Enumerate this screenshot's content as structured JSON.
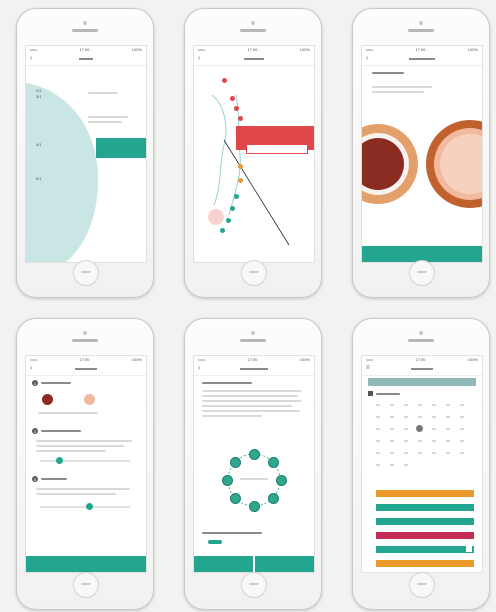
{
  "status_bar": {
    "carrier": "•••••",
    "time": "17:00",
    "battery": "100%"
  },
  "colors": {
    "teal": "#23a590",
    "dark_teal": "#1c7e6c",
    "light_teal": "#c9e5e4",
    "red": "#e0474a",
    "dark_red": "#8b2c22",
    "peach": "#f0b9a0",
    "orange": "#ec9a2c",
    "magenta": "#c32d55"
  },
  "icons": [
    "back-arrow-icon",
    "menu-icon",
    "calendar-icon",
    "body-outline-icon",
    "check-icon"
  ],
  "screens": [
    {
      "id": "screen-1",
      "has_primary_button": true,
      "row_labels": [
        "2/1",
        "3/1",
        "4/1",
        "5/1"
      ]
    },
    {
      "id": "screen-2",
      "has_primary_button": false
    },
    {
      "id": "screen-3",
      "has_primary_button": true
    },
    {
      "id": "screen-4",
      "has_primary_button": true,
      "section_numbers": [
        "1",
        "2",
        "3"
      ]
    },
    {
      "id": "screen-5",
      "has_primary_button": true,
      "dial_points": 8
    },
    {
      "id": "screen-6",
      "has_primary_button": false,
      "event_bar_colors": [
        "#ec9a2c",
        "#23a590",
        "#23a590",
        "#c32d55",
        "#23a590",
        "#ec9a2c"
      ]
    }
  ]
}
